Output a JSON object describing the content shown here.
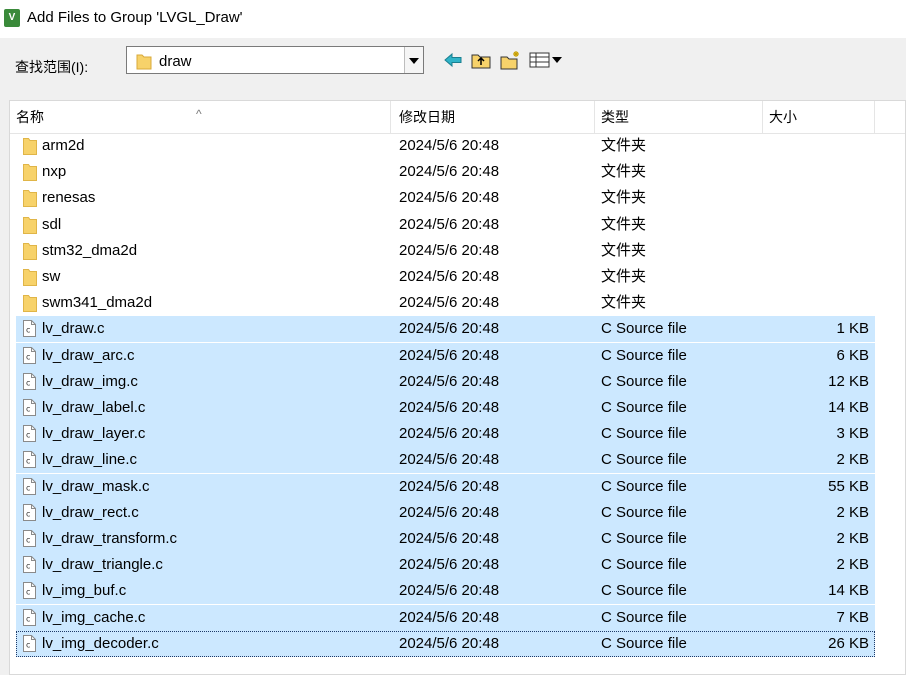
{
  "window": {
    "title": "Add Files to Group 'LVGL_Draw'",
    "icon": "keil-uvision-icon"
  },
  "lookin": {
    "label": "查找范围(I):",
    "value": "draw"
  },
  "toolbar": [
    "back-arrow-icon",
    "up-folder-icon",
    "new-folder-icon",
    "view-menu-icon"
  ],
  "columns": {
    "name": "名称",
    "date": "修改日期",
    "type": "类型",
    "size": "大小"
  },
  "sort": {
    "column": "name",
    "direction": "ascending"
  },
  "files": [
    {
      "name": "arm2d",
      "date": "2024/5/6 20:48",
      "type": "文件夹",
      "size": "",
      "kind": "folder"
    },
    {
      "name": "nxp",
      "date": "2024/5/6 20:48",
      "type": "文件夹",
      "size": "",
      "kind": "folder"
    },
    {
      "name": "renesas",
      "date": "2024/5/6 20:48",
      "type": "文件夹",
      "size": "",
      "kind": "folder"
    },
    {
      "name": "sdl",
      "date": "2024/5/6 20:48",
      "type": "文件夹",
      "size": "",
      "kind": "folder"
    },
    {
      "name": "stm32_dma2d",
      "date": "2024/5/6 20:48",
      "type": "文件夹",
      "size": "",
      "kind": "folder"
    },
    {
      "name": "sw",
      "date": "2024/5/6 20:48",
      "type": "文件夹",
      "size": "",
      "kind": "folder"
    },
    {
      "name": "swm341_dma2d",
      "date": "2024/5/6 20:48",
      "type": "文件夹",
      "size": "",
      "kind": "folder"
    },
    {
      "name": "lv_draw.c",
      "date": "2024/5/6 20:48",
      "type": "C Source file",
      "size": "1 KB",
      "kind": "file",
      "selected": true
    },
    {
      "name": "lv_draw_arc.c",
      "date": "2024/5/6 20:48",
      "type": "C Source file",
      "size": "6 KB",
      "kind": "file",
      "selected": true
    },
    {
      "name": "lv_draw_img.c",
      "date": "2024/5/6 20:48",
      "type": "C Source file",
      "size": "12 KB",
      "kind": "file",
      "selected": true
    },
    {
      "name": "lv_draw_label.c",
      "date": "2024/5/6 20:48",
      "type": "C Source file",
      "size": "14 KB",
      "kind": "file",
      "selected": true
    },
    {
      "name": "lv_draw_layer.c",
      "date": "2024/5/6 20:48",
      "type": "C Source file",
      "size": "3 KB",
      "kind": "file",
      "selected": true
    },
    {
      "name": "lv_draw_line.c",
      "date": "2024/5/6 20:48",
      "type": "C Source file",
      "size": "2 KB",
      "kind": "file",
      "selected": true
    },
    {
      "name": "lv_draw_mask.c",
      "date": "2024/5/6 20:48",
      "type": "C Source file",
      "size": "55 KB",
      "kind": "file",
      "selected": true
    },
    {
      "name": "lv_draw_rect.c",
      "date": "2024/5/6 20:48",
      "type": "C Source file",
      "size": "2 KB",
      "kind": "file",
      "selected": true
    },
    {
      "name": "lv_draw_transform.c",
      "date": "2024/5/6 20:48",
      "type": "C Source file",
      "size": "2 KB",
      "kind": "file",
      "selected": true
    },
    {
      "name": "lv_draw_triangle.c",
      "date": "2024/5/6 20:48",
      "type": "C Source file",
      "size": "2 KB",
      "kind": "file",
      "selected": true
    },
    {
      "name": "lv_img_buf.c",
      "date": "2024/5/6 20:48",
      "type": "C Source file",
      "size": "14 KB",
      "kind": "file",
      "selected": true
    },
    {
      "name": "lv_img_cache.c",
      "date": "2024/5/6 20:48",
      "type": "C Source file",
      "size": "7 KB",
      "kind": "file",
      "selected": true
    },
    {
      "name": "lv_img_decoder.c",
      "date": "2024/5/6 20:48",
      "type": "C Source file",
      "size": "26 KB",
      "kind": "file",
      "selected": true,
      "focused": true
    }
  ],
  "colors": {
    "selection": "#cce8ff",
    "folder": "#f7d26a",
    "focus_outline": "#1e3a68"
  }
}
